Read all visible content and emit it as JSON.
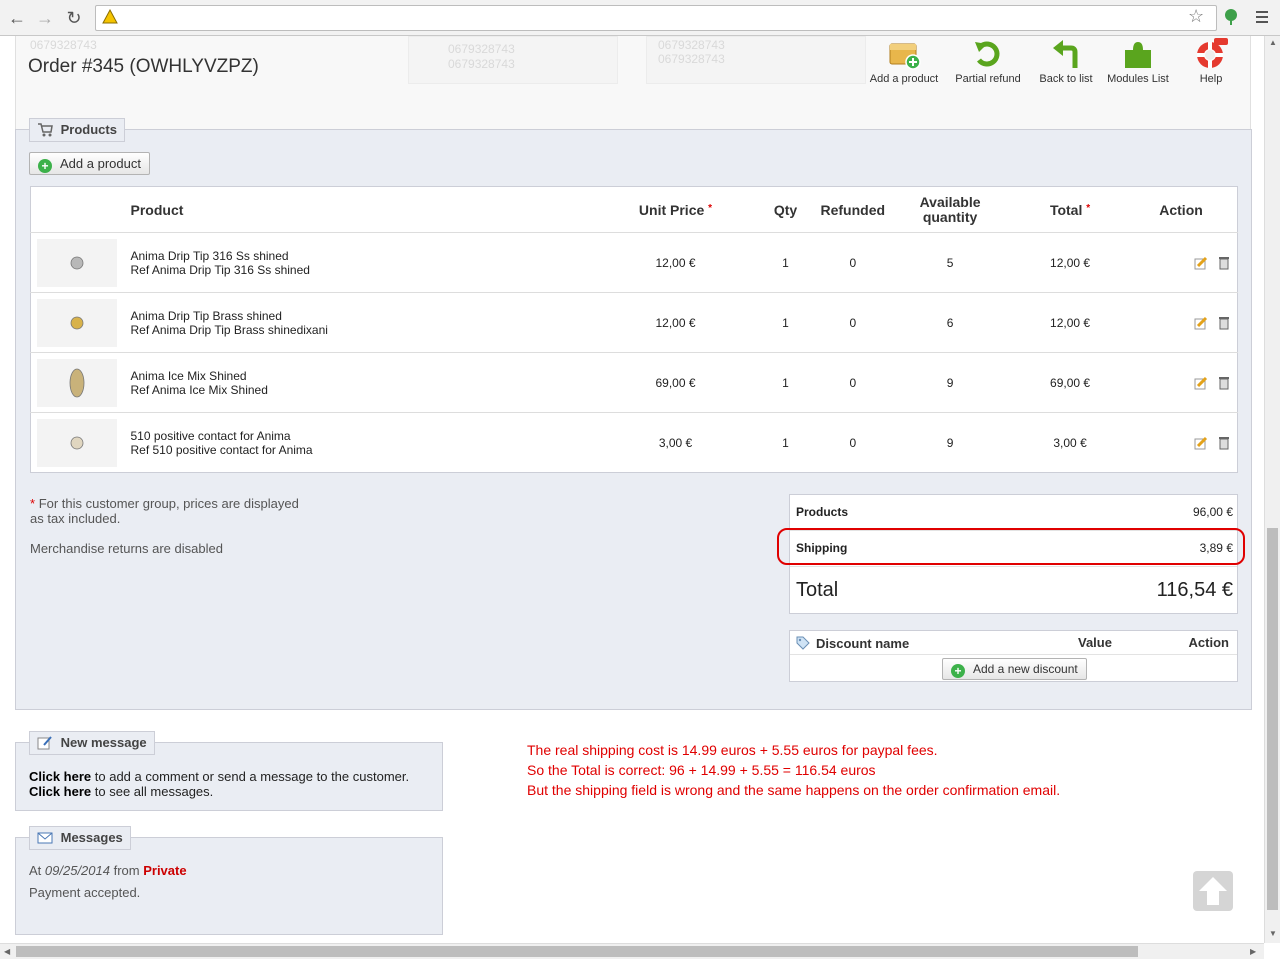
{
  "browser": {
    "back_icon": "arrow-left-icon",
    "forward_icon": "arrow-right-icon",
    "reload_icon": "reload-icon",
    "url": ""
  },
  "header": {
    "title": "Order #345 (OWHLYVZPZ)",
    "ghost_phone": "0679328743",
    "toolbar": [
      {
        "label": "Add a product",
        "icon": "add-product-icon"
      },
      {
        "label": "Partial refund",
        "icon": "partial-refund-icon"
      },
      {
        "label": "Back to list",
        "icon": "back-arrow-icon"
      },
      {
        "label": "Modules List",
        "icon": "puzzle-icon"
      },
      {
        "label": "Help",
        "icon": "lifebuoy-icon"
      }
    ]
  },
  "products": {
    "legend": "Products",
    "add_button": "Add a product",
    "columns": {
      "product": "Product",
      "unit_price": "Unit Price",
      "qty": "Qty",
      "refunded": "Refunded",
      "available_1": "Available",
      "available_2": "quantity",
      "total": "Total",
      "action": "Action",
      "required_mark": "*"
    },
    "rows": [
      {
        "name": "Anima Drip Tip 316 Ss shined",
        "ref": "Ref Anima Drip Tip 316 Ss shined",
        "unit_price": "12,00 €",
        "qty": "1",
        "refunded": "0",
        "available": "5",
        "total": "12,00 €"
      },
      {
        "name": "Anima Drip Tip Brass shined",
        "ref": "Ref Anima Drip Tip Brass shinedixani",
        "unit_price": "12,00 €",
        "qty": "1",
        "refunded": "0",
        "available": "6",
        "total": "12,00 €"
      },
      {
        "name": "Anima Ice Mix Shined",
        "ref": "Ref Anima Ice Mix Shined",
        "unit_price": "69,00 €",
        "qty": "1",
        "refunded": "0",
        "available": "9",
        "total": "69,00 €"
      },
      {
        "name": "510 positive contact for Anima",
        "ref": "Ref 510 positive contact for Anima",
        "unit_price": "3,00 €",
        "qty": "1",
        "refunded": "0",
        "available": "9",
        "total": "3,00 €"
      }
    ],
    "tax_note_mark": "*",
    "tax_note_1": "For this customer group, prices are displayed",
    "tax_note_2": "as tax included.",
    "returns_note": "Merchandise returns are disabled"
  },
  "totals": {
    "products_label": "Products",
    "products_value": "96,00 €",
    "shipping_label": "Shipping",
    "shipping_value": "3,89 €",
    "total_label": "Total",
    "total_value": "116,54 €"
  },
  "discounts": {
    "name_header": "Discount name",
    "value_header": "Value",
    "action_header": "Action",
    "add_button": "Add a new discount"
  },
  "annotation": {
    "line1": "The real shipping cost is 14.99 euros + 5.55 euros for paypal fees.",
    "line2": "So the Total is correct: 96 + 14.99 + 5.55 = 116.54 euros",
    "line3": "But the shipping field is wrong and the same happens on the order confirmation email.",
    "color": "#e00000"
  },
  "new_message": {
    "legend": "New message",
    "click_here_1": "Click here",
    "text_1": " to add a comment or send a message to the customer.",
    "click_here_2": "Click here",
    "text_2": " to see all messages."
  },
  "messages": {
    "legend": "Messages",
    "at": "At ",
    "date": "09/25/2014",
    "from": " from ",
    "author": "Private",
    "body": "Payment accepted."
  }
}
